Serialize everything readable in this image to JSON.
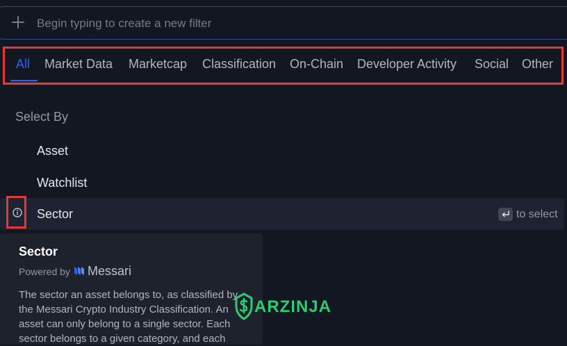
{
  "search": {
    "placeholder": "Begin typing to create a new filter"
  },
  "tabs": [
    {
      "label": "All"
    },
    {
      "label": "Market Data"
    },
    {
      "label": "Marketcap"
    },
    {
      "label": "Classification"
    },
    {
      "label": "On-Chain"
    },
    {
      "label": "Developer Activity"
    },
    {
      "label": "Social"
    },
    {
      "label": "Other"
    }
  ],
  "select_by": {
    "title": "Select By",
    "options": [
      {
        "label": "Asset"
      },
      {
        "label": "Watchlist"
      },
      {
        "label": "Sector"
      }
    ],
    "hint": "to select"
  },
  "tooltip": {
    "title": "Sector",
    "powered_by": "Powered by",
    "provider": "Messari",
    "description": "The sector an asset belongs to, as classified by the Messari Crypto Industry Classification. An asset can only belong to a single sector. Each sector belongs to a given category, and each"
  },
  "watermark": {
    "text": "ARZINJA"
  },
  "colors": {
    "background": "#131722",
    "accent": "#2962ff",
    "annotation_red": "#e53935",
    "watermark_green": "#2ecc71"
  }
}
